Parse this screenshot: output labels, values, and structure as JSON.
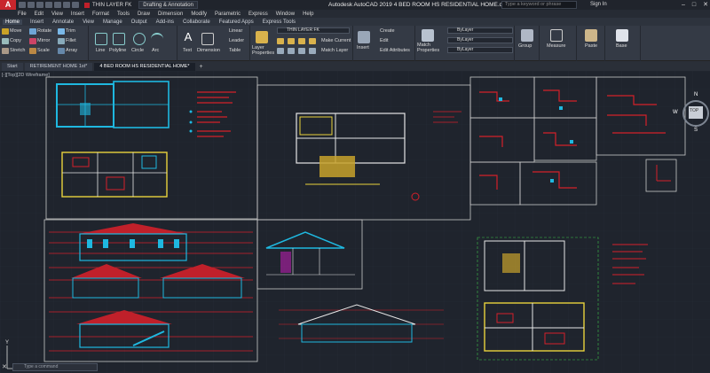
{
  "titlebar": {
    "app_letter": "A",
    "layer_name": "THIN LAYER FK",
    "workspace": "Drafting & Annotation",
    "title": "Autodesk AutoCAD 2019    4 BED ROOM HS RESIDENTIAL HOME.dwg",
    "search_placeholder": "Type a keyword or phrase",
    "signin": "Sign In"
  },
  "menu": [
    "File",
    "Edit",
    "View",
    "Insert",
    "Format",
    "Tools",
    "Draw",
    "Dimension",
    "Modify",
    "Parametric",
    "Express",
    "Window",
    "Help"
  ],
  "ribbon_tabs": [
    "Home",
    "Insert",
    "Annotate",
    "View",
    "Manage",
    "Output",
    "Add-ins",
    "Collaborate",
    "Featured Apps",
    "Express Tools"
  ],
  "ribbon": {
    "modify": [
      "Move",
      "Rotate",
      "Trim",
      "Copy",
      "Mirror",
      "Fillet",
      "Stretch",
      "Scale",
      "Array"
    ],
    "draw": [
      "Line",
      "Polyline",
      "Circle",
      "Arc"
    ],
    "annotation": [
      "Text",
      "Dimension",
      "Linear",
      "Leader",
      "Table"
    ],
    "layers": {
      "label": "Layer Properties",
      "current": "THIN LAYER FK",
      "make_current": "Make Current",
      "match_layer": "Match Layer"
    },
    "block": {
      "insert": "Insert",
      "create": "Create",
      "edit": "Edit",
      "edit_attributes": "Edit Attributes"
    },
    "properties": {
      "match": "Match Properties",
      "color": "ByLayer",
      "linetype": "ByLayer",
      "lineweight": "ByLayer"
    },
    "group": "Group",
    "utilities": "Measure",
    "clipboard": "Paste",
    "view": "Base"
  },
  "file_tabs": [
    "Start",
    "RETIREMENT HOME 1st*",
    "4 BED ROOM HS RESIDENTIAL HOME*"
  ],
  "viewport": {
    "label": "[-][Top][2D Wireframe]",
    "viewcube": {
      "top": "TOP",
      "north": "N",
      "west": "W",
      "south": "S"
    },
    "command_placeholder": "Type a command"
  },
  "colors": {
    "red": "#d4202a",
    "yellow": "#e8d23c",
    "cyan": "#1fb8e0",
    "white": "#e6e6e6",
    "green": "#3fc24a",
    "background": "#1f242d"
  }
}
